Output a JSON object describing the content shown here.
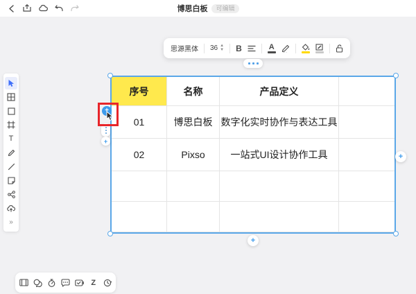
{
  "topbar": {
    "title": "博思白板",
    "badge": "可编辑",
    "icons": [
      "back-icon",
      "export-icon",
      "cloud-sync-icon",
      "undo-icon",
      "redo-icon"
    ]
  },
  "format_toolbar": {
    "font_name": "思源黑体",
    "font_size": "36",
    "bold_label": "B",
    "text_color_label": "A",
    "fill_color_swatch": "#ffd900",
    "border_color_swatch": "#c9c9c9",
    "icons": [
      "font-size-stepper",
      "bold",
      "align",
      "text-color",
      "highlight-pen",
      "fill-color",
      "cell-border-color",
      "unlock"
    ]
  },
  "table": {
    "columns": [
      "序号",
      "名称",
      "产品定义",
      ""
    ],
    "rows": [
      [
        "01",
        "博思白板",
        "数字化实时协作与表达工具",
        ""
      ],
      [
        "02",
        "Pixso",
        "一站式UI设计协作工具",
        ""
      ],
      [
        "",
        "",
        "",
        ""
      ],
      [
        "",
        "",
        "",
        ""
      ]
    ],
    "header_highlight_color": "#ffe94d",
    "selection_color": "#5aa7e8"
  },
  "annotations": {
    "highlight_box_color": "#e8252a",
    "magic_button_glyph": "+",
    "plus_glyph": "+"
  },
  "sidebar": {
    "tools": [
      {
        "name": "select",
        "active": true
      },
      {
        "name": "table"
      },
      {
        "name": "shape"
      },
      {
        "name": "frame"
      },
      {
        "name": "text",
        "glyph": "T"
      },
      {
        "name": "pencil"
      },
      {
        "name": "line"
      },
      {
        "name": "sticky-note"
      },
      {
        "name": "connector"
      },
      {
        "name": "upload"
      },
      {
        "name": "expand",
        "glyph": "»"
      }
    ]
  },
  "bottom_toolbar": {
    "tools": [
      {
        "name": "presentation"
      },
      {
        "name": "comment"
      },
      {
        "name": "timer"
      },
      {
        "name": "chat"
      },
      {
        "name": "vote"
      },
      {
        "name": "zen-mode",
        "glyph": "Z"
      },
      {
        "name": "history"
      }
    ]
  }
}
